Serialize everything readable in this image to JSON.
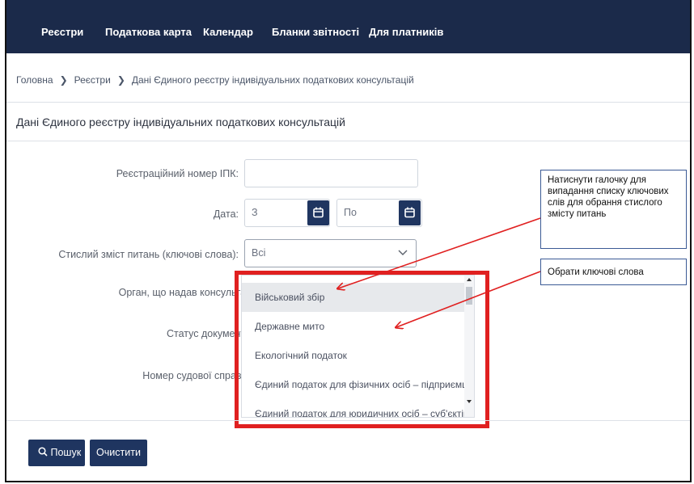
{
  "nav": {
    "items": [
      "Реєстри",
      "Податкова карта",
      "Календар",
      "Бланки звітності",
      "Для платників"
    ]
  },
  "breadcrumb": {
    "items": [
      "Головна",
      "Реєстри",
      "Дані Єдиного реєстру індивідуальних податкових консультацій"
    ]
  },
  "page": {
    "title": "Дані Єдиного реєстру індивідуальних податкових консультацій"
  },
  "form": {
    "reg_number_label": "Реєстраційний номер ІПК:",
    "reg_number_value": "",
    "date_label": "Дата:",
    "date_from_placeholder": "З",
    "date_to_placeholder": "По",
    "keywords_label": "Стислий зміст питань (ключові слова):",
    "keywords_value": "Всі",
    "authority_label": "Орган, що надав консультацію:",
    "status_label": "Статус документу:",
    "court_case_label": "Номер судової справи:"
  },
  "dropdown": {
    "options": [
      "Військовий збір",
      "Державне мито",
      "Екологічний податок",
      "Єдиний податок для фізичних осіб – підприємців (спр",
      "Єдиний податок для юридичних осіб – суб'єктів госпо"
    ],
    "selected_index": 0
  },
  "buttons": {
    "search": "Пошук",
    "clear": "Очистити"
  },
  "annotations": {
    "callout_1": "Натиснути галочку для випадання списку ключових слів для обрання стислого змісту питань",
    "callout_2": "Обрати ключові слова",
    "arrow_color": "#e02020",
    "highlight_color": "#e02020"
  },
  "colors": {
    "navbar": "#1b2a4a",
    "button": "#1f3560"
  }
}
